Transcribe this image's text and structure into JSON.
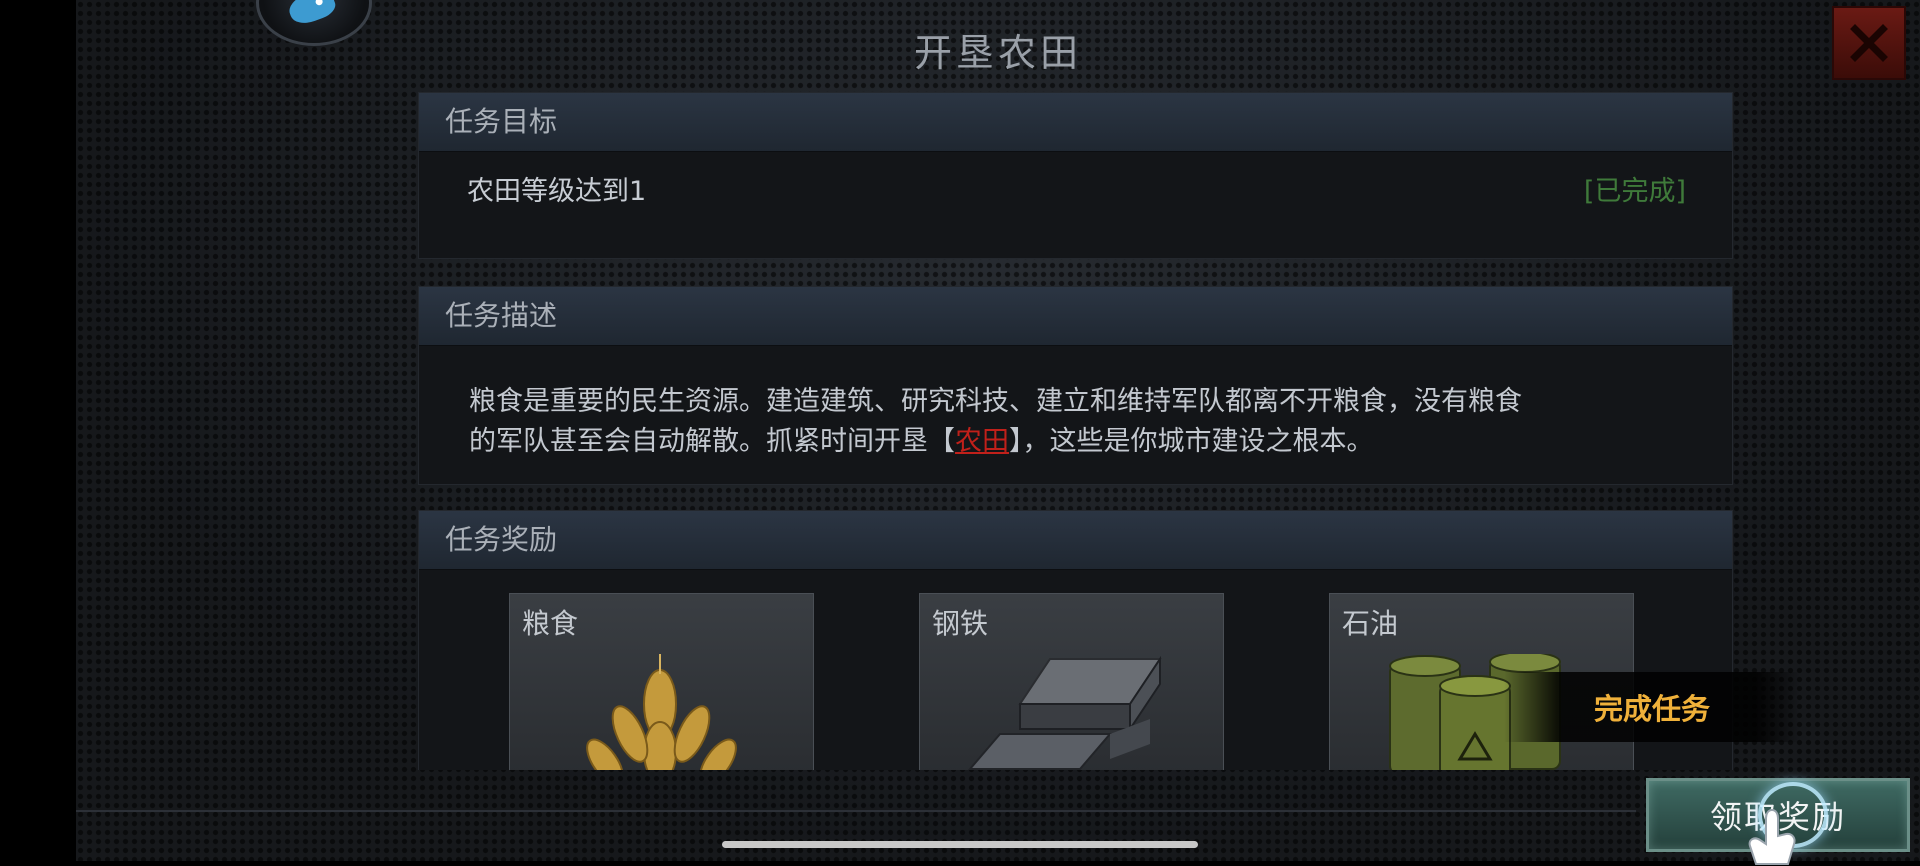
{
  "dialog": {
    "title": "开垦农田"
  },
  "goal": {
    "header": "任务目标",
    "text": "农田等级达到1",
    "status": "[已完成]"
  },
  "description": {
    "header": "任务描述",
    "line1": "粮食是重要的民生资源。建造建筑、研究科技、建立和维持军队都离不开粮食，没有粮食",
    "line2_pre": "的军队甚至会自动解散。抓紧时间开垦【",
    "line2_link": "农田",
    "line2_post": "】，这些是你城市建设之根本。"
  },
  "rewards": {
    "header": "任务奖励",
    "items": [
      {
        "label": "粮食",
        "icon": "wheat-icon"
      },
      {
        "label": "钢铁",
        "icon": "steel-ingot-icon"
      },
      {
        "label": "石油",
        "icon": "oil-barrel-icon"
      }
    ]
  },
  "tooltip": "完成任务",
  "claim_button": "领取奖励",
  "colors": {
    "status_complete": "#3f7a3a",
    "link_red": "#c0201a",
    "tooltip_gold": "#f0b13a",
    "close_red": "#6a1a14"
  }
}
